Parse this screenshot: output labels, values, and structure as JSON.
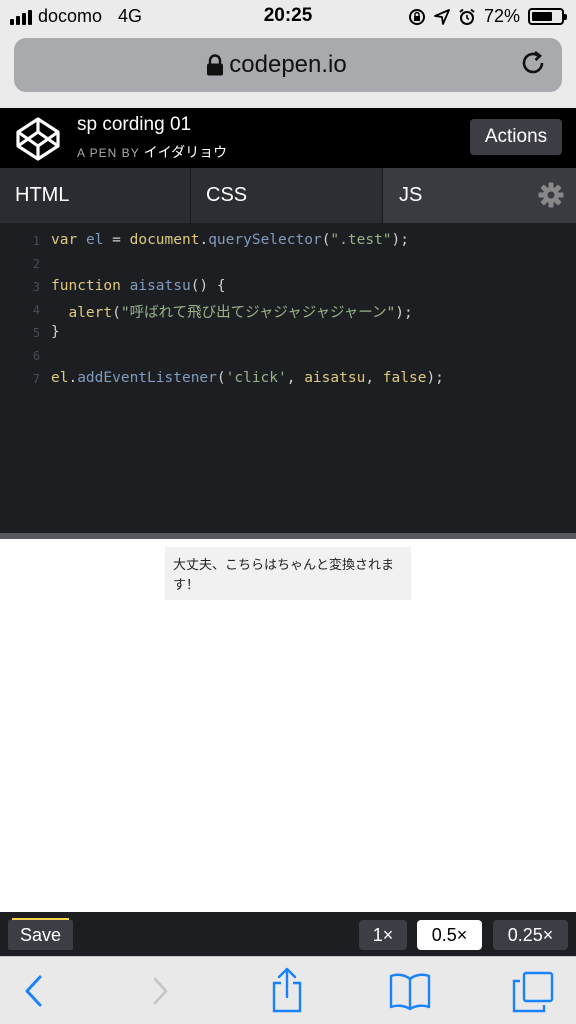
{
  "status_bar": {
    "carrier": "docomo",
    "network": "4G",
    "time": "20:25",
    "battery": "72%",
    "battery_level": 0.72
  },
  "browser": {
    "url": "codepen.io"
  },
  "pen": {
    "title": "sp cording 01",
    "by_label": "A PEN BY",
    "author": "イイダリョウ",
    "actions_label": "Actions"
  },
  "tabs": [
    {
      "label": "HTML"
    },
    {
      "label": "CSS"
    },
    {
      "label": "JS"
    }
  ],
  "code": {
    "line_numbers": [
      "1",
      "2",
      "3",
      "4",
      "5",
      "6",
      "7"
    ],
    "l1": {
      "kw1": "var",
      "v1": "el",
      "p1": " = ",
      "kw2": "document",
      "p2": ".",
      "fn": "querySelector",
      "p3": "(",
      "str": "\".test\"",
      "p4": ");"
    },
    "l3": {
      "kw1": "function",
      "fn": "aisatsu",
      "p1": "() {"
    },
    "l4": {
      "kw1": "alert",
      "p1": "(",
      "str": "\"呼ばれて飛び出てジャジャジャジャーン\"",
      "p2": ");"
    },
    "l5": {
      "p1": "}"
    },
    "l7": {
      "kw1": "el",
      "p1": ".",
      "fn": "addEventListener",
      "p2": "(",
      "str": "'click'",
      "p3": ", ",
      "kw2": "aisatsu",
      "p4": ", ",
      "kw3": "false",
      "p5": ");"
    }
  },
  "preview": {
    "test_text": "大丈夫、こちらはちゃんと変換されます！"
  },
  "bottom_bar": {
    "save_label": "Save",
    "zoom_options": [
      "1×",
      "0.5×",
      "0.25×"
    ],
    "zoom_selected": "0.5×"
  },
  "colors": {
    "accent_yellow": "#f5d04a",
    "ios_blue": "#1a82fb"
  }
}
